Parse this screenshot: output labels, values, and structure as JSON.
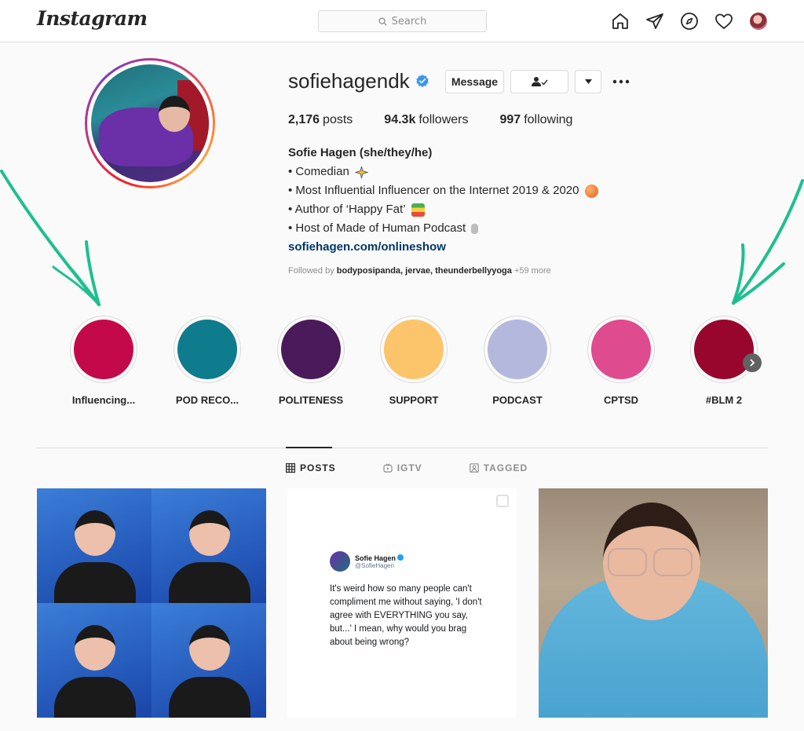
{
  "nav": {
    "logo": "Instagram",
    "search_placeholder": "Search",
    "icons": [
      "home-icon",
      "direct-icon",
      "explore-icon",
      "heart-icon",
      "profile-avatar"
    ]
  },
  "profile": {
    "username": "sofiehagendk",
    "verified": true,
    "message_label": "Message",
    "stats": {
      "posts_count": "2,176",
      "posts_label": "posts",
      "followers_count": "94.3k",
      "followers_label": "followers",
      "following_count": "997",
      "following_label": "following"
    },
    "bio": {
      "name": "Sofie Hagen (she/they/he)",
      "lines": [
        "• Comedian",
        "• Most Influential Influencer on the Internet 2019 & 2020",
        "• Author of ‘Happy Fat’",
        "• Host of Made of Human Podcast"
      ],
      "link": "sofiehagen.com/onlineshow"
    },
    "followed_by": {
      "prefix": "Followed by",
      "names": "bodyposipanda, jervae, theunderbellyyoga",
      "more": "+59 more"
    }
  },
  "highlights": [
    {
      "label": "Influencing...",
      "color": "#c4094a"
    },
    {
      "label": "POD RECO...",
      "color": "#0f7c8e"
    },
    {
      "label": "POLITENESS",
      "color": "#4b1a5a"
    },
    {
      "label": "SUPPORT",
      "color": "#fcc56b"
    },
    {
      "label": "PODCAST",
      "color": "#b4b8dc"
    },
    {
      "label": "CPTSD",
      "color": "#df4b8f"
    },
    {
      "label": "#BLM 2",
      "color": "#98062e"
    }
  ],
  "tabs": [
    {
      "label": "POSTS",
      "active": true
    },
    {
      "label": "IGTV",
      "active": false
    },
    {
      "label": "TAGGED",
      "active": false
    }
  ],
  "posts": {
    "tweet": {
      "name": "Sofie Hagen",
      "handle": "@SofieHagen",
      "text": "It's weird how so many people can't compliment me without saying, 'I don't agree with EVERYTHING you say, but...' I mean, why would you brag about being wrong?"
    }
  },
  "colors": {
    "accent_link": "#00376b",
    "annotation_arrow": "#1fbf8f"
  }
}
